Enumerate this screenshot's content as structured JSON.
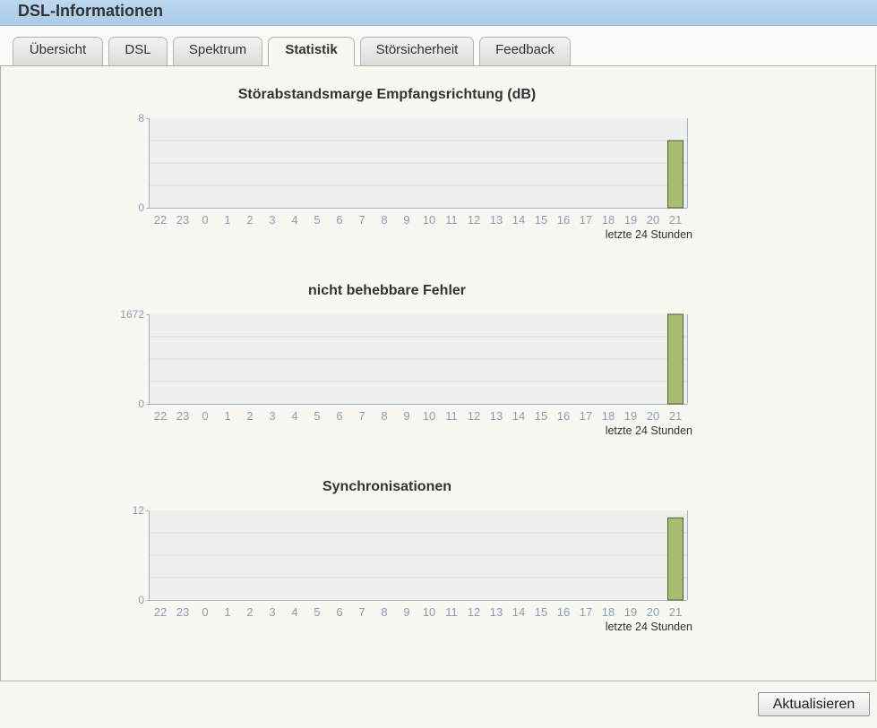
{
  "window": {
    "title": "DSL-Informationen"
  },
  "tabs": [
    {
      "label": "Übersicht",
      "active": false
    },
    {
      "label": "DSL",
      "active": false
    },
    {
      "label": "Spektrum",
      "active": false
    },
    {
      "label": "Statistik",
      "active": true
    },
    {
      "label": "Störsicherheit",
      "active": false
    },
    {
      "label": "Feedback",
      "active": false
    }
  ],
  "colors": {
    "bar_fill": "#a8bd72",
    "bar_stroke": "#4f6330",
    "plot_bg": "#efefef",
    "axis": "#9fb2c6",
    "tick_text": "#8a9db5"
  },
  "chart_data": [
    {
      "type": "bar",
      "title": "Störabstandsmarge Empfangsrichtung (dB)",
      "xlabel": "letzte 24 Stunden",
      "categories": [
        "22",
        "23",
        "0",
        "1",
        "2",
        "3",
        "4",
        "5",
        "6",
        "7",
        "8",
        "9",
        "10",
        "11",
        "12",
        "13",
        "14",
        "15",
        "16",
        "17",
        "18",
        "19",
        "20",
        "21"
      ],
      "values": [
        0,
        0,
        0,
        0,
        0,
        0,
        0,
        0,
        0,
        0,
        0,
        0,
        0,
        0,
        0,
        0,
        0,
        0,
        0,
        0,
        0,
        0,
        0,
        6
      ],
      "ylim": [
        0,
        8
      ],
      "yticks": [
        "0",
        "8"
      ],
      "grid": true
    },
    {
      "type": "bar",
      "title": "nicht behebbare Fehler",
      "xlabel": "letzte 24 Stunden",
      "categories": [
        "22",
        "23",
        "0",
        "1",
        "2",
        "3",
        "4",
        "5",
        "6",
        "7",
        "8",
        "9",
        "10",
        "11",
        "12",
        "13",
        "14",
        "15",
        "16",
        "17",
        "18",
        "19",
        "20",
        "21"
      ],
      "values": [
        0,
        0,
        0,
        0,
        0,
        0,
        0,
        0,
        0,
        0,
        0,
        0,
        0,
        0,
        0,
        0,
        0,
        0,
        0,
        0,
        0,
        0,
        0,
        1672
      ],
      "ylim": [
        0,
        1672
      ],
      "yticks": [
        "0",
        "1672"
      ],
      "grid": true
    },
    {
      "type": "bar",
      "title": "Synchronisationen",
      "xlabel": "letzte 24 Stunden",
      "categories": [
        "22",
        "23",
        "0",
        "1",
        "2",
        "3",
        "4",
        "5",
        "6",
        "7",
        "8",
        "9",
        "10",
        "11",
        "12",
        "13",
        "14",
        "15",
        "16",
        "17",
        "18",
        "19",
        "20",
        "21"
      ],
      "values": [
        0,
        0,
        0,
        0,
        0,
        0,
        0,
        0,
        0,
        0,
        0,
        0,
        0,
        0,
        0,
        0,
        0,
        0,
        0,
        0,
        0,
        0,
        0,
        11
      ],
      "ylim": [
        0,
        12
      ],
      "yticks": [
        "0",
        "12"
      ],
      "grid": true
    }
  ],
  "footer": {
    "refresh_label": "Aktualisieren"
  }
}
